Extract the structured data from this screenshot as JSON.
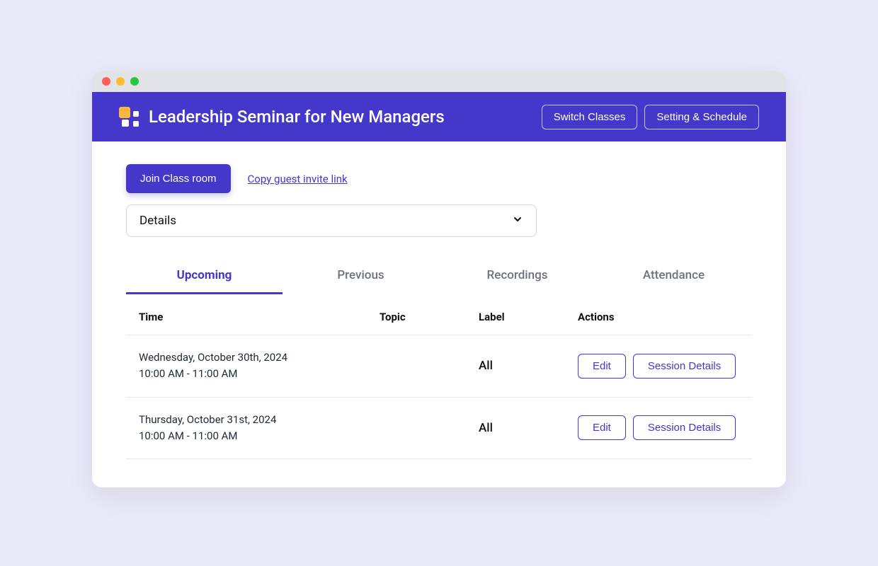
{
  "header": {
    "title": "Leadership Seminar for New Managers",
    "switch_classes_label": "Switch Classes",
    "setting_schedule_label": "Setting & Schedule"
  },
  "actions": {
    "join_label": "Join Class room",
    "copy_link_label": "Copy guest invite link"
  },
  "details_select": {
    "label": "Details"
  },
  "tabs": {
    "upcoming": "Upcoming",
    "previous": "Previous",
    "recordings": "Recordings",
    "attendance": "Attendance",
    "active": "upcoming"
  },
  "table": {
    "headers": {
      "time": "Time",
      "topic": "Topic",
      "label": "Label",
      "actions": "Actions"
    },
    "action_labels": {
      "edit": "Edit",
      "session_details": "Session Details"
    },
    "rows": [
      {
        "date": "Wednesday, October 30th, 2024",
        "time": "10:00 AM - 11:00 AM",
        "topic": "",
        "label": "All"
      },
      {
        "date": "Thursday, October 31st, 2024",
        "time": "10:00 AM - 11:00 AM",
        "topic": "",
        "label": "All"
      }
    ]
  }
}
